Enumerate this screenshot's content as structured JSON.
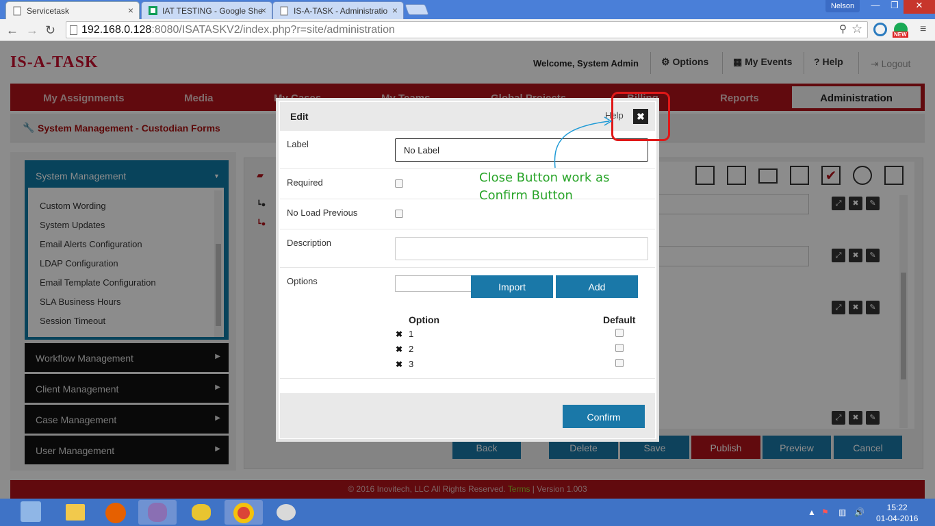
{
  "browser": {
    "tabs": [
      {
        "label": "Servicetask",
        "active": true
      },
      {
        "label": "IAT TESTING - Google She",
        "active": false
      },
      {
        "label": "IS-A-TASK - Administratio",
        "active": false
      }
    ],
    "user": "Nelson",
    "url_host": "192.168.0.128",
    "url_rest": ":8080/ISATASKV2/index.php?r=site/administration",
    "ext_badge": "NEW"
  },
  "app": {
    "logo": "IS-A-TASK",
    "welcome": "Welcome, System Admin",
    "header_links": {
      "options": "Options",
      "events": "My Events",
      "help": "Help",
      "logout": "Logout"
    },
    "nav": [
      "My Assignments",
      "Media",
      "My Cases",
      "My Teams",
      "Global Projects",
      "Billing",
      "Reports"
    ],
    "nav_active": "Administration",
    "subtitle": "System Management - Custodian Forms"
  },
  "sidebar": {
    "title": "System Management",
    "items": [
      "Custom Wording",
      "System Updates",
      "Email Alerts Configuration",
      "LDAP Configuration",
      "Email Template Configuration",
      "SLA Business Hours",
      "Session Timeout"
    ],
    "sections": [
      "Workflow Management",
      "Client Management",
      "Case Management",
      "User Management"
    ]
  },
  "bottom_buttons": {
    "back": "Back",
    "delete": "Delete",
    "save": "Save",
    "publish": "Publish",
    "preview": "Preview",
    "cancel": "Cancel"
  },
  "footer": {
    "copyright": "© 2016 Inovitech, LLC All Rights Reserved.",
    "terms": "Terms",
    "version": "Version 1.003"
  },
  "modal": {
    "title": "Edit",
    "help": "Help",
    "label_label": "Label",
    "label_value": "No Label",
    "required_label": "Required",
    "no_load_label": "No Load Previous",
    "description_label": "Description",
    "options_label": "Options",
    "import_label": "Import",
    "add_label": "Add",
    "col_option": "Option",
    "col_default": "Default",
    "options": [
      {
        "value": "1"
      },
      {
        "value": "2"
      },
      {
        "value": "3"
      }
    ],
    "confirm_label": "Confirm"
  },
  "annotation": {
    "line1": "Close Button work as",
    "line2": "Confirm Button"
  },
  "taskbar": {
    "time": "15:22",
    "date": "01-04-2016"
  },
  "colors": {
    "brand_red": "#b1131b",
    "modal_blue": "#1a78a8",
    "sidebar_blue": "#0f7aa6",
    "annotation_green": "#2aa52a",
    "annotation_red": "#e01818"
  }
}
